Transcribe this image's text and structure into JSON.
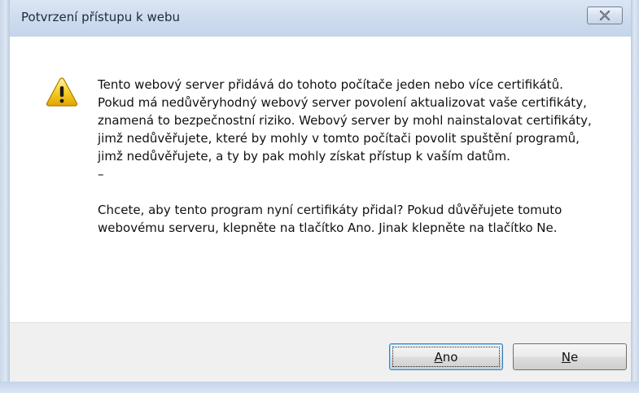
{
  "window": {
    "title": "Potvrzení přístupu k webu",
    "close_icon": "close-icon"
  },
  "message": {
    "icon": "warning-icon",
    "paragraph1": "Tento webový server přidává do tohoto počítače jeden nebo více certifikátů. Pokud má nedůvěryhodný webový server povolení aktualizovat vaše certifikáty, znamená to bezpečnostní riziko. Webový server by mohl nainstalovat certifikáty, jimž nedůvěřujete, které by mohly v tomto počítači povolit spuštění programů, jimž nedůvěřujete, a ty by pak mohly získat přístup k vaším datům.",
    "dash": "–",
    "paragraph2": "Chcete, aby tento program nyní certifikáty přidal? Pokud důvěřujete tomuto webovému serveru, klepněte na tlačítko Ano. Jinak klepněte na tlačítko Ne."
  },
  "buttons": {
    "yes": {
      "mnemonic": "A",
      "rest": "no"
    },
    "no": {
      "mnemonic": "N",
      "rest": "e"
    }
  },
  "colors": {
    "title_bar": "#cfdcee",
    "footer": "#f0f0f0",
    "warning_yellow": "#f5c400",
    "default_button_border": "#3c7fb1"
  }
}
